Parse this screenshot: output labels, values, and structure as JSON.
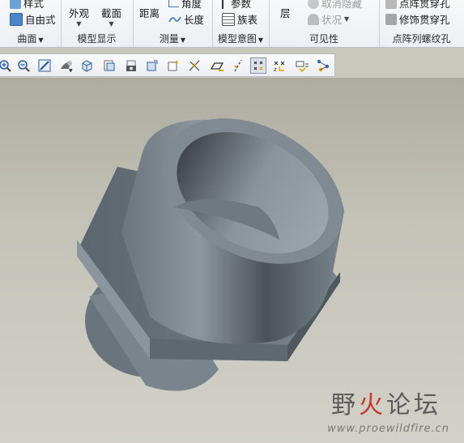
{
  "ribbon": {
    "groups": [
      {
        "label": "曲面",
        "buttons": [
          {
            "label": "样式",
            "dim": false
          },
          {
            "label": "自由式",
            "dim": false
          }
        ]
      },
      {
        "label": "模型显示",
        "buttons": [
          {
            "label": "外观"
          },
          {
            "label": "截面"
          }
        ]
      },
      {
        "label": "测量",
        "buttons": [
          {
            "label": "距离"
          },
          {
            "label": "角度"
          },
          {
            "label": "长度"
          }
        ]
      },
      {
        "label": "模型意图",
        "buttons": [
          {
            "label": "参数"
          },
          {
            "label": "族表"
          }
        ]
      },
      {
        "label": "可见性",
        "buttons": [
          {
            "label": "层"
          },
          {
            "label": "取消隐藏"
          },
          {
            "label": "状况"
          }
        ]
      },
      {
        "label": "点阵列螺纹孔",
        "buttons": [
          {
            "label": "点阵贯穿孔"
          },
          {
            "label": "修饰贯穿孔"
          }
        ]
      }
    ]
  },
  "toolbar": {
    "buttons": [
      {
        "name": "zoom-in-icon"
      },
      {
        "name": "zoom-out-icon"
      },
      {
        "name": "refit-icon"
      },
      {
        "name": "display-style-icon"
      },
      {
        "name": "saved-orientation-icon"
      },
      {
        "name": "view-manager-icon"
      },
      {
        "name": "camera-icon"
      },
      {
        "name": "spin-center-icon"
      },
      {
        "name": "regenerate-icon"
      },
      {
        "name": "datum-display-icon"
      },
      {
        "name": "plane-display-icon"
      },
      {
        "name": "axis-display-icon"
      },
      {
        "name": "point-display-icon"
      },
      {
        "name": "coordinate-display-icon"
      },
      {
        "name": "annotation-display-icon"
      },
      {
        "name": "analysis-display-icon"
      }
    ]
  },
  "watermark": {
    "title_part1": "野",
    "title_part2": "火",
    "title_part3": "论坛",
    "url": "www.proewildfire.cn"
  },
  "colors": {
    "highlight_underline": "#c41fcb",
    "model_gray": "#7d8890",
    "viewport_bg": "#c9c8bd"
  }
}
